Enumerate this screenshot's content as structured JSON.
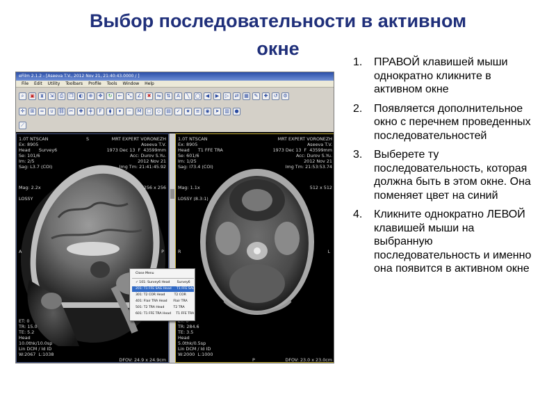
{
  "slide": {
    "title_line1": "Выбор последовательности в активном",
    "title_line2": "окне"
  },
  "app": {
    "title": "eFilm 2.1.2 - [Aseeva T.V., 2012 Nov 21, 21:40:43.0000 / ]",
    "menu": [
      "File",
      "Edit",
      "Utility",
      "Toolbars",
      "Profile",
      "Tools",
      "Window",
      "Help"
    ]
  },
  "viewport_left": {
    "top_left": "1.0T NTSCAN\nEx: 8905\nHead      Survey6\nSe: 101/6\nIm: 2/5\nSag: L3.7 (COI)",
    "top_right": "MRT EXPERT VORONEZH\nAseeva T.V.\n1973 Dec 13  F  43599mm\nAcc: Durov S.Yu.\n2012 Nov 21\nImg Tm: 21:41:45.92",
    "mag": "Mag: 2.2x",
    "matrix": "256 x 256",
    "lossy": "LOSSY",
    "side_left": "A",
    "side_right": "P",
    "orient_top": "S",
    "bottom_left": "ET: 0\nTR: 15.0\nTE: 5.2\nHead\n10.0thk/10.0sp\nLin DCM / Id ID\nW:2067  L:1038",
    "bottom_right": "DFOV: 24.9 x 24.9cm"
  },
  "viewport_right": {
    "top_left": "1.0T NTSCAN\nEx: 8905\nHead      T1 FFE TRA\nSe: 601/6\nIm: 1/25\nSag: I73.4 (COI)",
    "top_right": "MRT EXPERT VORONEZH\nAseeva T.V.\n1973 Dec 13  F  43599mm\nAcc: Durov S.Yu.\n2012 Nov 21\nImg Tm: 21:53:53.74",
    "mag": "Mag: 1.1x",
    "matrix": "512 x 512",
    "lossy": "LOSSY (8.3:1)",
    "side_left": "R",
    "side_right": "L",
    "orient_top": "A",
    "orient_bottom": "P",
    "bottom_left": "ET: 0\nTR: 284.6\nTE: 3.5\nHead\n5.0thk/0.5sp\nLin DCM / Id ID\nW:2000  L:1000",
    "bottom_right": "DFOV: 23.0 x 23.0cm"
  },
  "context_menu": {
    "close": "Close Menu",
    "items": [
      "✓ 101: Survey6 Head       Survey6",
      "201: T1 FFE SAG Head     T1 FFE SAG",
      "301: T2 COR Head         T2 COR",
      "401: Flair TRA Head      Flair TRA",
      "501: T2 TRA Head         T2 TRA",
      "601: T1 FFE TRA Head     T1 FFE TRA"
    ],
    "selected_index": 1
  },
  "steps": [
    {
      "num": "1.",
      "text": "ПРАВОЙ клавишей мыши однократно кликните в активном окне"
    },
    {
      "num": "2.",
      "text": "Появляется дополнительное окно с перечнем проведенных последовательностей"
    },
    {
      "num": "3.",
      "text": "Выберете ту последовательность, которая должна быть в этом окне. Она поменяет цвет на синий"
    },
    {
      "num": "4.",
      "text": "Кликните однократно ЛЕВОЙ клавишей мыши на выбранную последовательность и именно она появится в активном окне"
    }
  ],
  "colors": {
    "title": "#1f2f7a",
    "selection": "#316ac5"
  }
}
